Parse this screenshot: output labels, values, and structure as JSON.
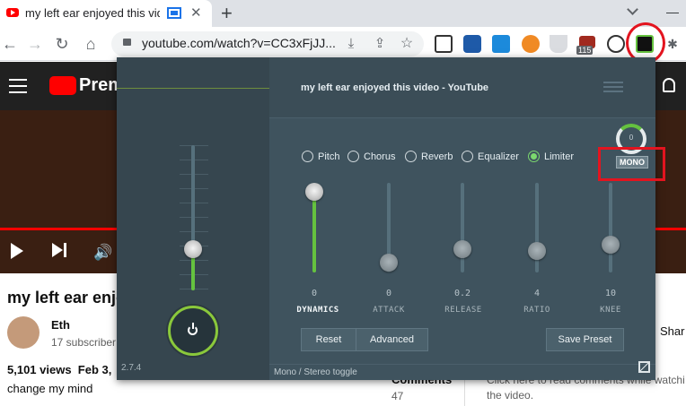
{
  "browser": {
    "tab_title": "my left ear enjoyed this video - YouTube",
    "new_tab": "+",
    "url": "youtube.com/watch?v=CC3xFjJJ...",
    "badge": "115"
  },
  "youtube": {
    "brand": "Premi",
    "video_title": "my left ear enjo",
    "channel": "Eth",
    "subscribers": "17 subscriber",
    "stats": "5,101 views  Feb 3,",
    "description": "change my mind",
    "comments_label": "Comments",
    "comments_count": "47",
    "share": "Shar",
    "comment_hint_1": "Click here to read comments while watchi",
    "comment_hint_2": "the video."
  },
  "eq": {
    "title": "my left ear enjoyed this video - YouTube",
    "version": "2.7.4",
    "dial_value": "0",
    "mono_label": "MONO",
    "footer": "Mono / Stereo toggle",
    "effects": [
      {
        "label": "Pitch",
        "selected": false
      },
      {
        "label": "Chorus",
        "selected": false
      },
      {
        "label": "Reverb",
        "selected": false
      },
      {
        "label": "Equalizer",
        "selected": false
      },
      {
        "label": "Limiter",
        "selected": true
      }
    ],
    "sliders": [
      {
        "label": "DYNAMICS",
        "value": "0"
      },
      {
        "label": "ATTACK",
        "value": "0"
      },
      {
        "label": "RELEASE",
        "value": "0.2"
      },
      {
        "label": "RATIO",
        "value": "4"
      },
      {
        "label": "KNEE",
        "value": "10"
      }
    ],
    "buttons": {
      "reset": "Reset",
      "advanced": "Advanced",
      "save": "Save Preset"
    }
  },
  "colors": {
    "accent": "#65c23f",
    "panel": "#3f535e",
    "annotation": "#e3141f"
  }
}
